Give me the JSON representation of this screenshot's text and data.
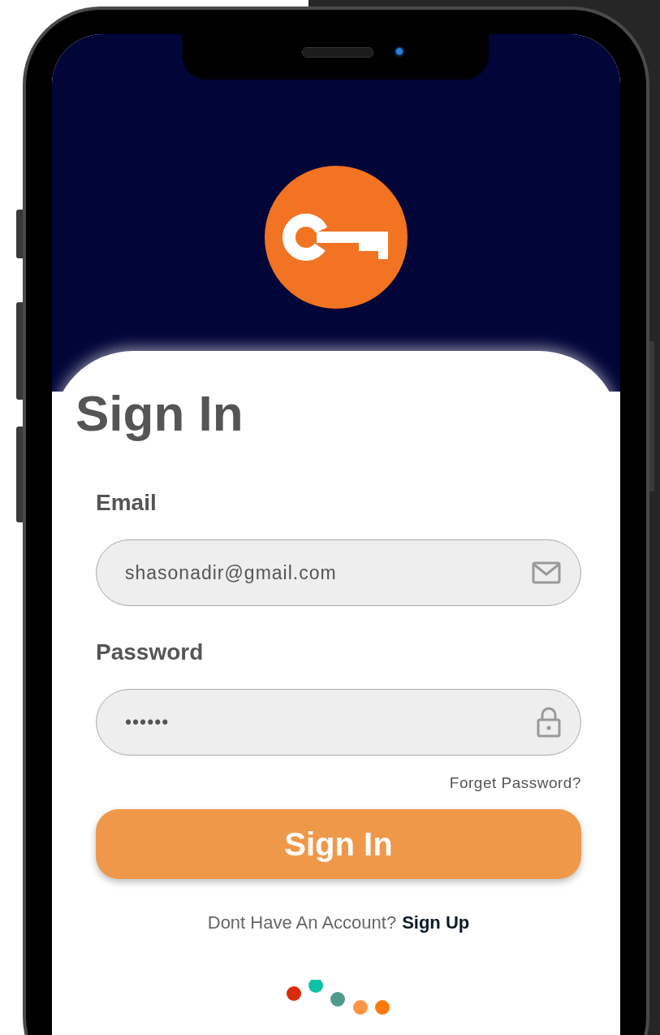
{
  "title": "Sign In",
  "fields": [
    {
      "kind": "email",
      "label": "Email",
      "value": "shasonadir@gmail.com"
    },
    {
      "kind": "password",
      "label": "Password",
      "value": "••••••"
    }
  ],
  "forgot_link": "Forget Password?",
  "submit_button": "Sign In",
  "signup_prompt": {
    "text": "Dont Have An Account?",
    "link": "Sign Up"
  },
  "loader_dots": [
    {
      "color": "#d92b0a"
    },
    {
      "color": "#0ec3a5"
    },
    {
      "color": "#4f9a8c"
    },
    {
      "color": "#ff9444"
    },
    {
      "color": "#ff7a0a"
    }
  ]
}
